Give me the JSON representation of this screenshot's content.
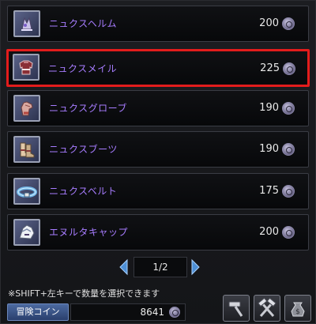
{
  "items": [
    {
      "name": "ニュクスヘルム",
      "price": "200",
      "icon": "helm-icon"
    },
    {
      "name": "ニュクスメイル",
      "price": "225",
      "icon": "armor-icon",
      "selected": true
    },
    {
      "name": "ニュクスグローブ",
      "price": "190",
      "icon": "glove-icon"
    },
    {
      "name": "ニュクスブーツ",
      "price": "190",
      "icon": "boots-icon"
    },
    {
      "name": "ニュクスベルト",
      "price": "175",
      "icon": "belt-icon"
    },
    {
      "name": "エヌルタキャップ",
      "price": "200",
      "icon": "cap-icon"
    }
  ],
  "pager": {
    "label": "1/2"
  },
  "hint": "※SHIFT+左キーで数量を選択できます",
  "currency": {
    "label": "冒険コイン",
    "value": "8641"
  },
  "colors": {
    "item_name": "#a77cff",
    "selection": "#e31c1c",
    "coin_button": "#3a5588"
  },
  "tools": [
    "hammer-icon",
    "crossed-hammers-icon",
    "coin-bag-icon"
  ]
}
